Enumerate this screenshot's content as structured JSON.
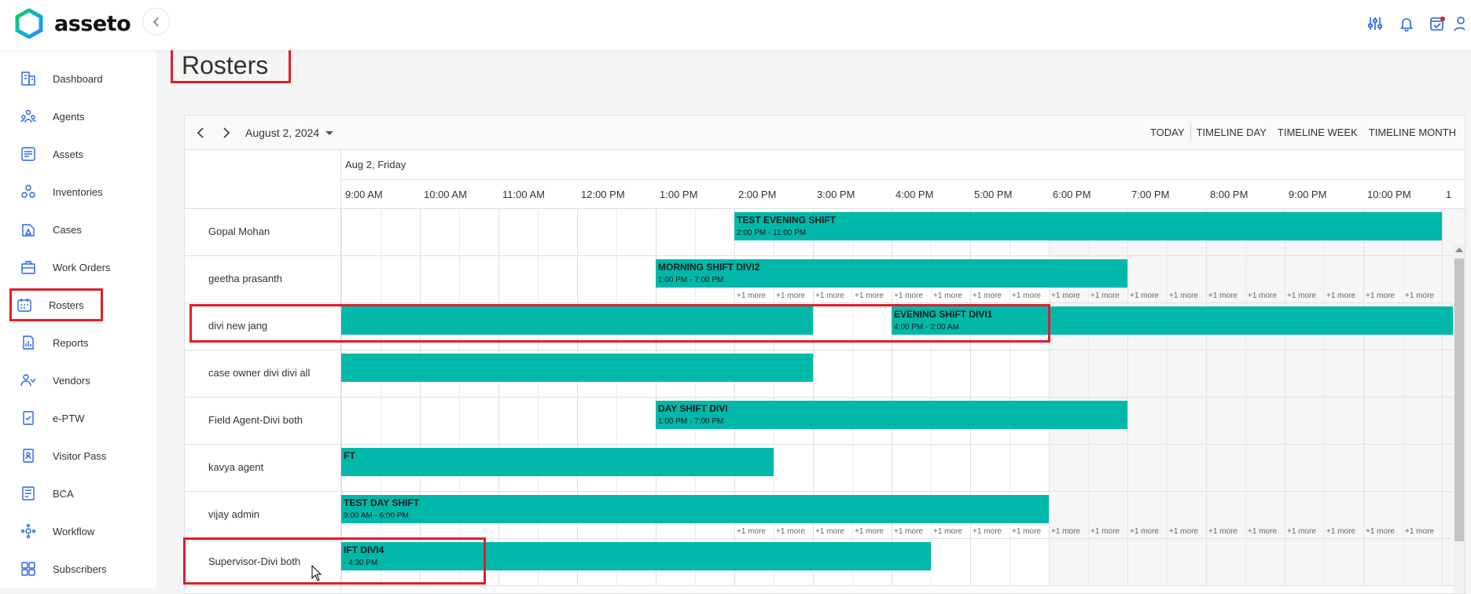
{
  "app": {
    "name": "asseto"
  },
  "header": {
    "icons": [
      "sliders-icon",
      "bell-icon",
      "calendar-check-icon",
      "user-icon"
    ]
  },
  "sidebar": {
    "items": [
      {
        "label": "Dashboard",
        "icon": "dashboard-icon"
      },
      {
        "label": "Agents",
        "icon": "agents-icon"
      },
      {
        "label": "Assets",
        "icon": "assets-icon"
      },
      {
        "label": "Inventories",
        "icon": "inventories-icon"
      },
      {
        "label": "Cases",
        "icon": "cases-icon"
      },
      {
        "label": "Work Orders",
        "icon": "work-orders-icon"
      },
      {
        "label": "Rosters",
        "icon": "rosters-icon",
        "active": true
      },
      {
        "label": "Reports",
        "icon": "reports-icon"
      },
      {
        "label": "Vendors",
        "icon": "vendors-icon"
      },
      {
        "label": "e-PTW",
        "icon": "eptw-icon"
      },
      {
        "label": "Visitor Pass",
        "icon": "visitor-pass-icon"
      },
      {
        "label": "BCA",
        "icon": "bca-icon"
      },
      {
        "label": "Workflow",
        "icon": "workflow-icon"
      },
      {
        "label": "Subscribers",
        "icon": "subscribers-icon"
      }
    ]
  },
  "page": {
    "title": "Rosters"
  },
  "scheduler": {
    "current_date": "August 2, 2024",
    "views": [
      "TODAY",
      "TIMELINE DAY",
      "TIMELINE WEEK",
      "TIMELINE MONTH"
    ],
    "day_header": "Aug 2, Friday",
    "time_slots": [
      "9:00 AM",
      "10:00 AM",
      "11:00 AM",
      "12:00 PM",
      "1:00 PM",
      "2:00 PM",
      "3:00 PM",
      "4:00 PM",
      "5:00 PM",
      "6:00 PM",
      "7:00 PM",
      "8:00 PM",
      "9:00 PM",
      "10:00 PM",
      "1"
    ],
    "more_label": "+1 more",
    "resources": [
      {
        "name": "Gopal Mohan",
        "events": [
          {
            "title": "TEST EVENING SHIFT",
            "time": "2:00 PM - 11:00 PM",
            "start": 14,
            "end": 23
          }
        ]
      },
      {
        "name": "geetha prasanth",
        "events": [
          {
            "title": "MORNING SHIFT DIVI2",
            "time": "1:00 PM - 7:00 PM",
            "start": 13,
            "end": 19
          }
        ],
        "more_from": 14.0
      },
      {
        "name": "divi new jang",
        "events": [
          {
            "title": "",
            "time": "",
            "start": 9,
            "end": 15
          },
          {
            "title": "EVENING SHIFT DIVI1",
            "time": "4:00 PM - 2:00 AM",
            "start": 16,
            "end": 26
          }
        ]
      },
      {
        "name": "case owner divi divi all",
        "events": [
          {
            "title": "",
            "time": "",
            "start": 9,
            "end": 15
          }
        ]
      },
      {
        "name": "Field Agent-Divi both",
        "events": [
          {
            "title": "DAY SHIFT DIVI",
            "time": "1:00 PM - 7:00 PM",
            "start": 13,
            "end": 19
          }
        ]
      },
      {
        "name": "kavya agent",
        "events": [
          {
            "title": "FT",
            "time": "",
            "start": 9,
            "end": 14.5
          }
        ]
      },
      {
        "name": "vijay admin",
        "events": [
          {
            "title": "TEST DAY SHIFT",
            "time": "9:00 AM - 6:00 PM",
            "start": 9,
            "end": 18
          }
        ],
        "more_from": 14.0
      },
      {
        "name": "Supervisor-Divi both",
        "events": [
          {
            "title": "IFT DIVI4",
            "time": "- 4:30 PM",
            "start": 9,
            "end": 16.5
          }
        ]
      }
    ]
  }
}
